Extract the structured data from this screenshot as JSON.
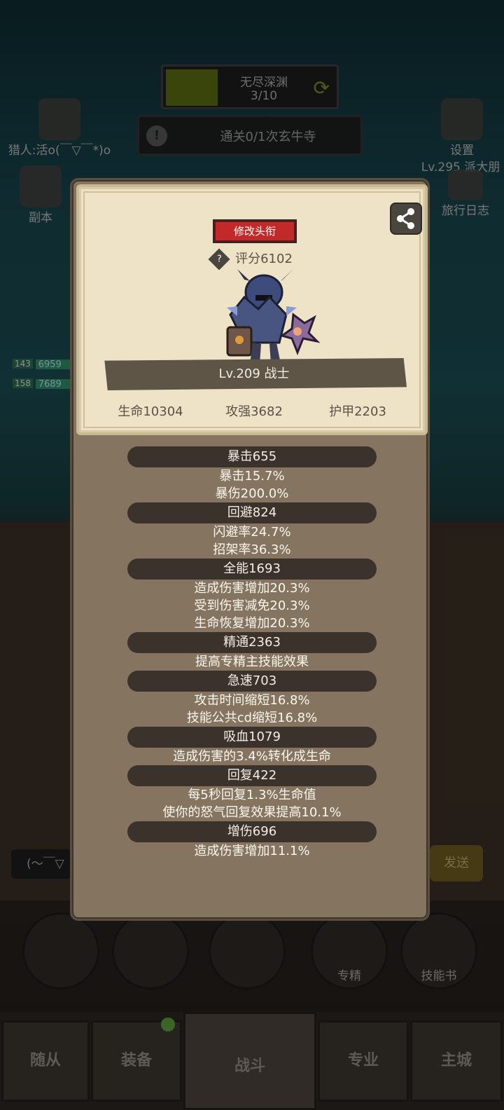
{
  "background": {
    "top_banner": {
      "title": "无尽深渊",
      "progress": "3/10"
    },
    "quest": {
      "text": "通关0/1次玄牛寺"
    },
    "left_icons": [
      {
        "label": "猎人:活o(￣▽￣*)o"
      },
      {
        "label": "副本"
      }
    ],
    "right_icons": [
      {
        "label": "设置"
      },
      {
        "label": "Lv.295 派大朋"
      },
      {
        "label": "旅行日志"
      }
    ],
    "party": [
      {
        "level": "143",
        "hp": "6959"
      },
      {
        "level": "158",
        "hp": "7689"
      }
    ],
    "chat_placeholder": "(～￣▽",
    "send_label": "发送",
    "round_buttons": [
      {
        "label": ""
      },
      {
        "label": ""
      },
      {
        "label": ""
      },
      {
        "label": "专精"
      },
      {
        "label": "技能书"
      }
    ],
    "bottom_nav": {
      "followers": "随从",
      "equipment": "装备",
      "battle": "战斗",
      "profession": "专业",
      "main_city": "主城"
    }
  },
  "profile": {
    "edit_title_label": "修改头衔",
    "rating_label": "评分6102",
    "name": "Lv.209 战士",
    "hp": "生命10304",
    "attack": "攻强3682",
    "armor": "护甲2203"
  },
  "stats": [
    {
      "header": "暴击655",
      "lines": [
        "暴击15.7%",
        "暴伤200.0%"
      ]
    },
    {
      "header": "回避824",
      "lines": [
        "闪避率24.7%",
        "招架率36.3%"
      ]
    },
    {
      "header": "全能1693",
      "lines": [
        "造成伤害增加20.3%",
        "受到伤害减免20.3%",
        "生命恢复增加20.3%"
      ]
    },
    {
      "header": "精通2363",
      "lines": [
        "提高专精主技能效果"
      ]
    },
    {
      "header": "急速703",
      "lines": [
        "攻击时间缩短16.8%",
        "技能公共cd缩短16.8%"
      ]
    },
    {
      "header": "吸血1079",
      "lines": [
        "造成伤害的3.4%转化成生命"
      ]
    },
    {
      "header": "回复422",
      "lines": [
        "每5秒回复1.3%生命值",
        "使你的怒气回复效果提高10.1%"
      ]
    },
    {
      "header": "增伤696",
      "lines": [
        "造成伤害增加11.1%"
      ]
    }
  ],
  "colors": {
    "edit_button": "#c22a2a",
    "card_bg": "#eee3c7",
    "modal_bg": "#857560",
    "stat_header_bg": "#3b332b"
  }
}
